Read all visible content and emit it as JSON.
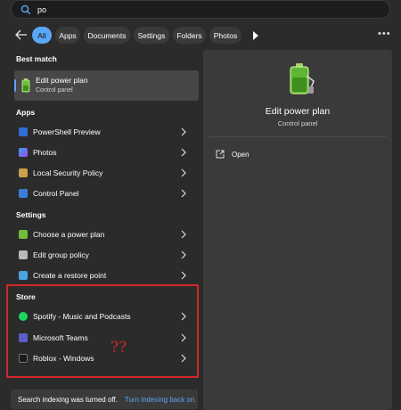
{
  "search": {
    "query": "po"
  },
  "filters": {
    "items": [
      {
        "label": "All",
        "active": true
      },
      {
        "label": "Apps",
        "active": false
      },
      {
        "label": "Documents",
        "active": false
      },
      {
        "label": "Settings",
        "active": false
      },
      {
        "label": "Folders",
        "active": false
      },
      {
        "label": "Photos",
        "active": false
      }
    ]
  },
  "best_match": {
    "heading": "Best match",
    "title": "Edit power plan",
    "subtitle": "Control panel"
  },
  "apps": {
    "heading": "Apps",
    "items": [
      {
        "label": "PowerShell Preview",
        "icon": "powershell-icon"
      },
      {
        "label": "Photos",
        "icon": "photos-icon"
      },
      {
        "label": "Local Security Policy",
        "icon": "security-policy-icon"
      },
      {
        "label": "Control Panel",
        "icon": "control-panel-icon"
      }
    ]
  },
  "settings": {
    "heading": "Settings",
    "items": [
      {
        "label": "Choose a power plan",
        "icon": "power-plan-icon"
      },
      {
        "label": "Edit group policy",
        "icon": "group-policy-icon"
      },
      {
        "label": "Create a restore point",
        "icon": "restore-point-icon"
      }
    ]
  },
  "store": {
    "heading": "Store",
    "items": [
      {
        "label": "Spotify - Music and Podcasts",
        "icon": "spotify-icon"
      },
      {
        "label": "Microsoft Teams",
        "icon": "teams-icon"
      },
      {
        "label": "Roblox - Windows",
        "icon": "roblox-icon"
      }
    ],
    "annotation": "??"
  },
  "notice": {
    "message": "Search indexing was turned off.",
    "link": "Turn indexing back on."
  },
  "detail": {
    "title": "Edit power plan",
    "subtitle": "Control panel",
    "action_label": "Open"
  },
  "colors": {
    "accent": "#5aa7f5",
    "annotation_red": "#d32828",
    "background": "#2b2b2b",
    "panel": "#3a3a3a"
  }
}
